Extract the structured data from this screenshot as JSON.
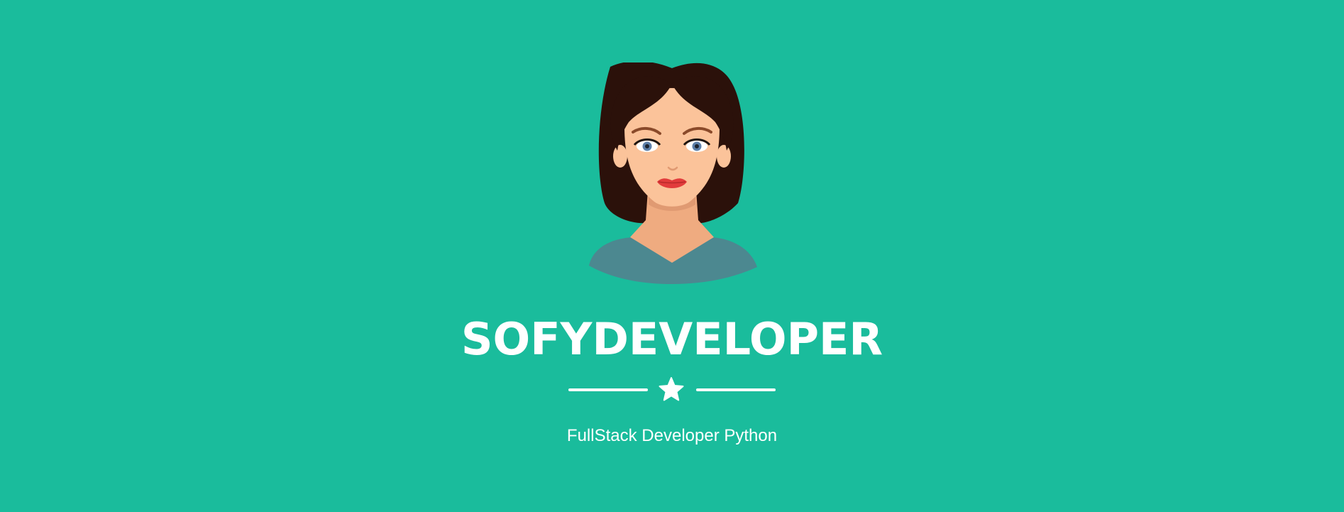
{
  "masthead": {
    "title": "SOFYDEVELOPER",
    "subtitle": "FullStack Developer Python",
    "divider_icon": "star-icon",
    "avatar_icon": "woman-avatar-icon"
  },
  "colors": {
    "background": "#1abc9c",
    "text": "#ffffff",
    "hair": "#2b110a",
    "skin": "#fbc39a",
    "shirt": "#4c8890",
    "lips": "#e23c3c"
  }
}
